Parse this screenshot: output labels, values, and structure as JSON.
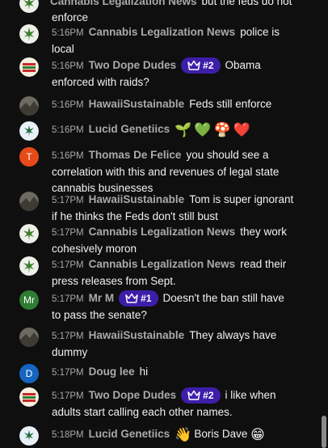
{
  "chat": {
    "messages": [
      {
        "avatar": "cannabis-leaf",
        "time": "",
        "author": "Cannabis Legalization News",
        "text": "but the feds do not enforce"
      },
      {
        "avatar": "cannabis-leaf",
        "time": "5:16PM",
        "author": "Cannabis Legalization News",
        "text": "police is local"
      },
      {
        "avatar": "two-dope-dudes-logo",
        "time": "5:16PM",
        "author": "Two Dope Dudes",
        "badge": "#2",
        "text": "Obama enforced with raids?"
      },
      {
        "avatar": "photo",
        "time": "5:16PM",
        "author": "HawaiiSustainable",
        "text": "Feds still enforce"
      },
      {
        "avatar": "lucid-logo",
        "time": "5:16PM",
        "author": "Lucid Genetiics",
        "text": "",
        "emojis": [
          "🌱",
          "💚",
          "🍄",
          "❤️"
        ]
      },
      {
        "avatar": "T",
        "avatar_color": "#e64a19",
        "time": "5:16PM",
        "author": "Thomas De Felice",
        "text": "you should see a correlation with this and revenues of legal state cannabis businesses"
      },
      {
        "avatar": "photo",
        "time": "5:17PM",
        "author": "HawaiiSustainable",
        "text": "Tom is super ignorant if he thinks the Feds don't still bust"
      },
      {
        "avatar": "cannabis-leaf",
        "time": "5:17PM",
        "author": "Cannabis Legalization News",
        "text": "they work cohesively moron"
      },
      {
        "avatar": "cannabis-leaf",
        "time": "5:17PM",
        "author": "Cannabis Legalization News",
        "text": "read their press releases from Sept."
      },
      {
        "avatar": "Mr",
        "avatar_color": "#2e7d32",
        "time": "5:17PM",
        "author": "Mr M",
        "badge": "#1",
        "text": "Doesn't the ban still have to pass the senate?"
      },
      {
        "avatar": "photo",
        "time": "5:17PM",
        "author": "HawaiiSustainable",
        "text": "They always have dummy"
      },
      {
        "avatar": "D",
        "avatar_color": "#1565c0",
        "time": "5:17PM",
        "author": "Doug lee",
        "text": "hi"
      },
      {
        "avatar": "two-dope-dudes-logo",
        "time": "5:17PM",
        "author": "Two Dope Dudes",
        "badge": "#2",
        "text": "i like when adults start calling each other names."
      },
      {
        "avatar": "lucid-logo",
        "time": "5:18PM",
        "author": "Lucid Genetiics",
        "text": "Boris Dave",
        "emojis_before": [
          "👋"
        ],
        "emojis_after": [
          "😁"
        ]
      }
    ]
  },
  "colors": {
    "background": "#0f0f0f",
    "badge": "#3d1ea8",
    "author": "#aaaaaa",
    "text": "#f1f1f1"
  },
  "icons": {
    "badge": "crown-icon"
  }
}
